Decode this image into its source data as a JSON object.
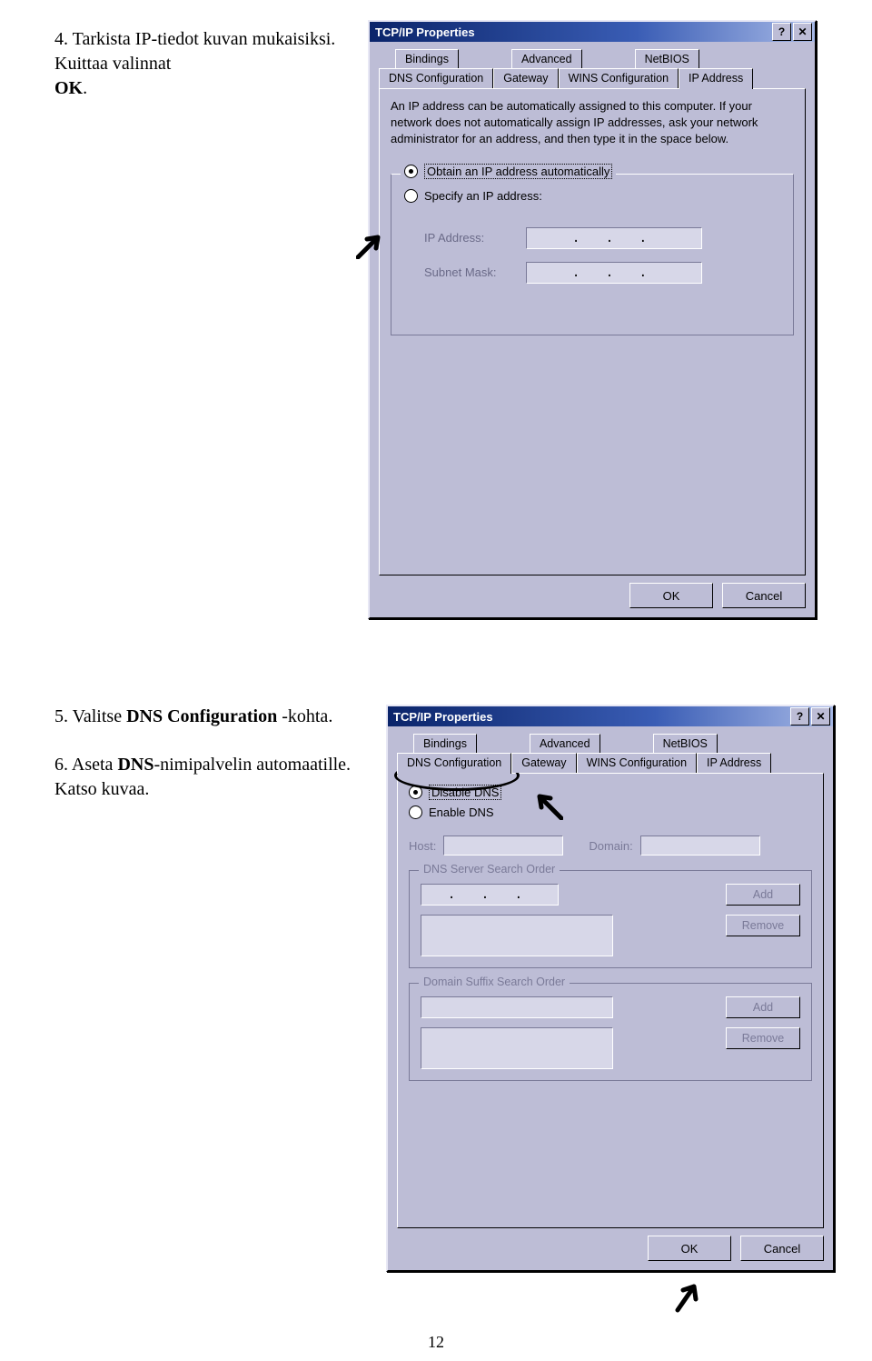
{
  "instructions": {
    "step4_num": "4.",
    "step4_a": " Tarkista IP-tiedot kuvan mukaisiksi. Kuittaa valinnat ",
    "step4_ok": "OK",
    "step4_dot": ".",
    "step5_num": "5.",
    "step5_a": " Valitse ",
    "step5_b": "DNS Configuration",
    "step5_c": " -kohta.",
    "step6_num": "6.",
    "step6_a": " Aseta ",
    "step6_b": "DNS",
    "step6_c": "-nimipalvelin automaatille. Katso kuvaa."
  },
  "dialog1": {
    "title": "TCP/IP Properties",
    "help": "?",
    "close": "✕",
    "tabs_row1": [
      "Bindings",
      "Advanced",
      "NetBIOS"
    ],
    "tabs_row2": [
      "DNS Configuration",
      "Gateway",
      "WINS Configuration",
      "IP Address"
    ],
    "active_tab": "IP Address",
    "desc": "An IP address can be automatically assigned to this computer. If your network does not automatically assign IP addresses, ask your network administrator for an address, and then type it in the space below.",
    "radio_obtain": "Obtain an IP address automatically",
    "radio_specify": "Specify an IP address:",
    "ip_label": "IP Address:",
    "subnet_label": "Subnet Mask:",
    "ip_dots": ".  .  .",
    "ok": "OK",
    "cancel": "Cancel"
  },
  "dialog2": {
    "title": "TCP/IP Properties",
    "help": "?",
    "close": "✕",
    "tabs_row1": [
      "Bindings",
      "Advanced",
      "NetBIOS"
    ],
    "tabs_row2": [
      "DNS Configuration",
      "Gateway",
      "WINS Configuration",
      "IP Address"
    ],
    "active_tab": "DNS Configuration",
    "radio_disable": "Disable DNS",
    "radio_enable": "Enable DNS",
    "host_label": "Host:",
    "domain_label": "Domain:",
    "dns_search_legend": "DNS Server Search Order",
    "domain_suffix_legend": "Domain Suffix Search Order",
    "add": "Add",
    "remove": "Remove",
    "ip_dots": ".  .  .",
    "ok": "OK",
    "cancel": "Cancel"
  },
  "page_number": "12"
}
